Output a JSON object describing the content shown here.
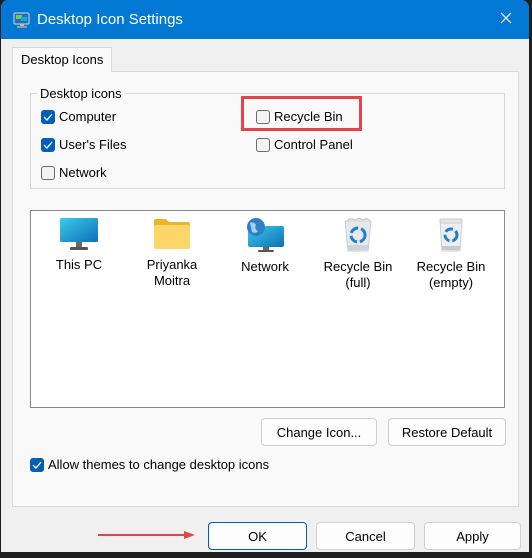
{
  "window": {
    "title": "Desktop Icon Settings",
    "title_icon": "monitor-settings-icon",
    "close_icon": "close-icon"
  },
  "tabs": [
    {
      "label": "Desktop Icons",
      "active": true
    }
  ],
  "desktop_icons_group": {
    "legend": "Desktop icons",
    "checkboxes": [
      {
        "label": "Computer",
        "checked": true
      },
      {
        "label": "User's Files",
        "checked": true
      },
      {
        "label": "Network",
        "checked": false
      },
      {
        "label": "Recycle Bin",
        "checked": false,
        "highlighted": true
      },
      {
        "label": "Control Panel",
        "checked": false
      }
    ]
  },
  "icon_list": [
    {
      "label_line1": "This PC",
      "label_line2": "",
      "icon": "monitor-icon"
    },
    {
      "label_line1": "Priyanka",
      "label_line2": "Moitra",
      "icon": "folder-icon"
    },
    {
      "label_line1": "Network",
      "label_line2": "",
      "icon": "network-globe-icon"
    },
    {
      "label_line1": "Recycle Bin",
      "label_line2": "(full)",
      "icon": "recycle-bin-full-icon"
    },
    {
      "label_line1": "Recycle Bin",
      "label_line2": "(empty)",
      "icon": "recycle-bin-empty-icon"
    }
  ],
  "actions": {
    "change_icon": "Change Icon...",
    "restore_default": "Restore Default"
  },
  "allow_themes": {
    "label": "Allow themes to change desktop icons",
    "checked": true
  },
  "footer": {
    "ok": "OK",
    "cancel": "Cancel",
    "apply": "Apply"
  },
  "annotation": {
    "highlight_color": "#e3434b",
    "arrow_target": "OK"
  }
}
